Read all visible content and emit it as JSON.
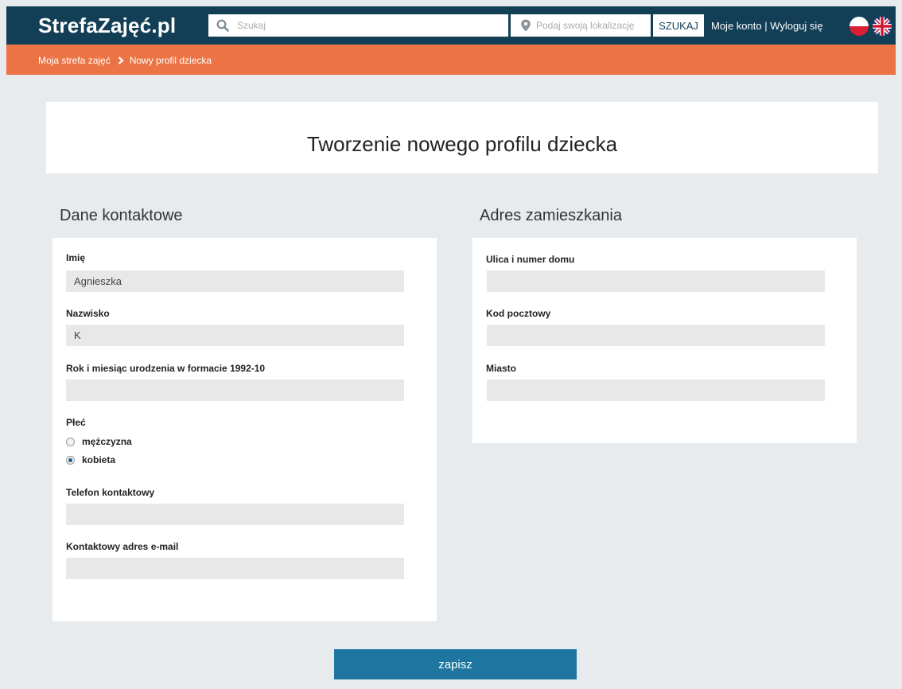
{
  "header": {
    "logo": "StrefaZajęć.pl",
    "search_placeholder": "Szukaj",
    "location_placeholder": "Podaj swoją lokalizację",
    "search_button": "SZUKAJ",
    "account_link": "Moje konto",
    "separator": " | ",
    "logout_link": "Wyloguj się",
    "icons": [
      "search-icon",
      "location-pin-icon",
      "flag-pl-icon",
      "flag-uk-icon"
    ]
  },
  "breadcrumb": {
    "items": [
      "Moja strefa zajęć",
      "Nowy profil dziecka"
    ]
  },
  "page": {
    "title": "Tworzenie nowego profilu dziecka"
  },
  "contact": {
    "section_title": "Dane kontaktowe",
    "first_name": {
      "label": "Imię",
      "value": "Agnieszka"
    },
    "last_name": {
      "label": "Nazwisko",
      "value": "K"
    },
    "birth": {
      "label": "Rok i miesiąc urodzenia w formacie 1992-10",
      "value": ""
    },
    "gender": {
      "label": "Płeć",
      "options": [
        "mężczyzna",
        "kobieta"
      ],
      "selected": "kobieta"
    },
    "phone": {
      "label": "Telefon kontaktowy",
      "value": ""
    },
    "email": {
      "label": "Kontaktowy adres e-mail",
      "value": ""
    }
  },
  "address": {
    "section_title": "Adres zamieszkania",
    "street": {
      "label": "Ulica i numer domu",
      "value": ""
    },
    "postal_code": {
      "label": "Kod pocztowy",
      "value": ""
    },
    "city": {
      "label": "Miasto",
      "value": ""
    }
  },
  "actions": {
    "save_label": "zapisz"
  },
  "colors": {
    "header_bg": "#123e56",
    "breadcrumb_bg": "#ec7343",
    "page_bg": "#e7ebee",
    "button_bg": "#1e76a0",
    "input_bg": "#e8e8e8"
  }
}
